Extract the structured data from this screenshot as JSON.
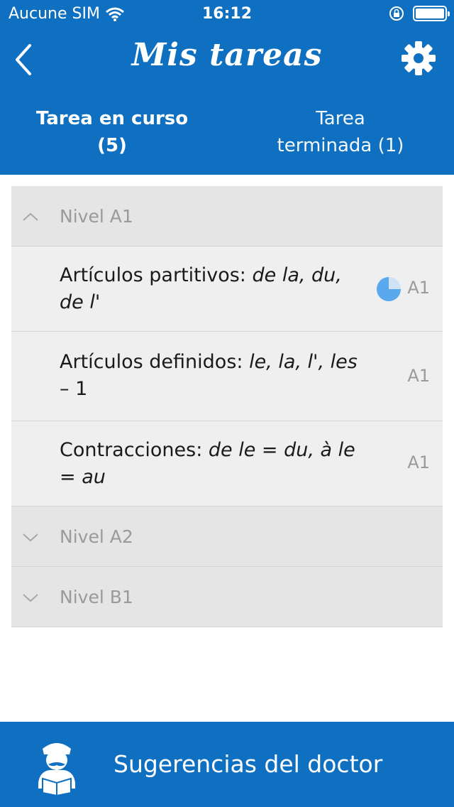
{
  "status_bar": {
    "carrier": "Aucune SIM",
    "time": "16:12"
  },
  "header": {
    "title": "Mis tareas",
    "tabs": [
      {
        "line1": "Tarea en curso",
        "line2": "(5)"
      },
      {
        "line1": "Tarea",
        "line2": "terminada (1)"
      }
    ]
  },
  "groups": [
    {
      "label": "Nivel A1",
      "expanded": true,
      "items": [
        {
          "plain": "Artículos partitivos: ",
          "italic": "de la, du, de l'",
          "level": "A1",
          "progress": 0.75
        },
        {
          "plain": "Artículos definidos: ",
          "italic": "le, la, l', les",
          "suffix": " – 1",
          "level": "A1"
        },
        {
          "plain": "Contracciones: ",
          "italic": "de le = du, à le = au",
          "level": "A1"
        }
      ]
    },
    {
      "label": "Nivel A2",
      "expanded": false
    },
    {
      "label": "Nivel B1",
      "expanded": false
    }
  ],
  "bottom_bar": {
    "label": "Sugerencias del doctor"
  },
  "colors": {
    "primary": "#0f6fc0",
    "progress": "#5aa9ef"
  }
}
